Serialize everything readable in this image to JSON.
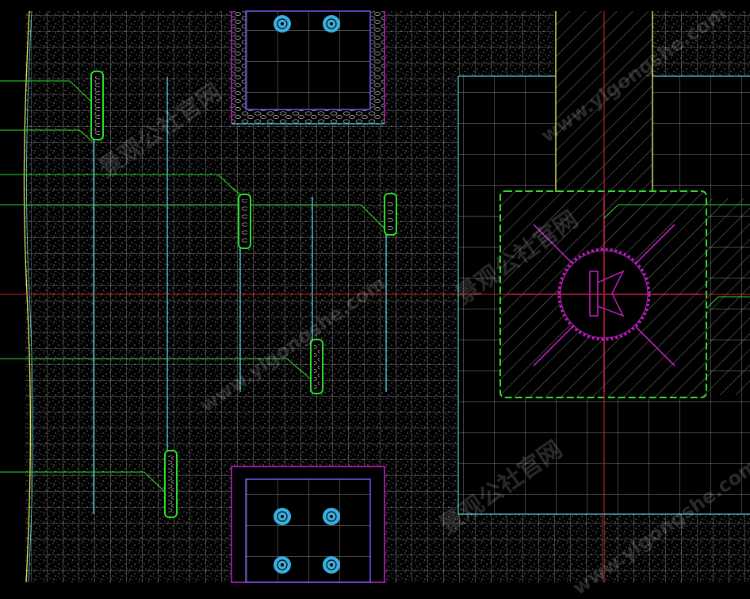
{
  "drawing": {
    "colors": {
      "background": "#000000",
      "grid": "#d8d8d8",
      "speckle": "#c8c8c8",
      "cyan": "#4fc8d8",
      "green": "#2ee02e",
      "magenta": "#c020c0",
      "yellow": "#e8e850",
      "red": "#d02020",
      "blue": "#3ab0e0"
    },
    "layers": [
      "paving-grid",
      "planting-strips",
      "fixtures",
      "tree-pit",
      "leader-lines",
      "centerlines"
    ]
  },
  "watermark": {
    "text": "景观公社官网",
    "text2": "www.ylgongshe.com"
  }
}
